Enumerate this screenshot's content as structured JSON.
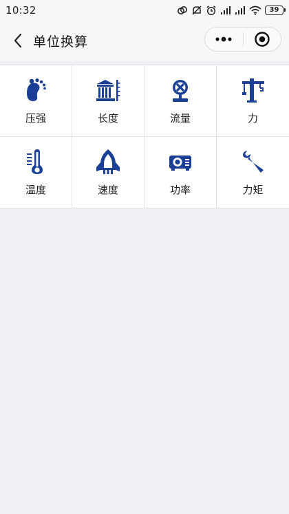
{
  "status_bar": {
    "time": "10:32",
    "battery": "39",
    "icons": [
      "cast-icon",
      "mute-icon",
      "alarm-icon",
      "signal-icon",
      "signal-icon",
      "wifi-icon",
      "battery-icon"
    ]
  },
  "nav": {
    "title": "单位换算",
    "back_icon": "chevron-left-icon",
    "more_icon": "more-dots-icon",
    "close_icon": "target-circle-icon"
  },
  "accent_color": "#1a3f94",
  "categories": [
    {
      "label": "压强",
      "icon": "footprint-icon"
    },
    {
      "label": "长度",
      "icon": "ruler-building-icon"
    },
    {
      "label": "流量",
      "icon": "valve-icon"
    },
    {
      "label": "力",
      "icon": "crane-icon"
    },
    {
      "label": "温度",
      "icon": "thermometer-icon"
    },
    {
      "label": "速度",
      "icon": "rocket-icon"
    },
    {
      "label": "功率",
      "icon": "projector-icon"
    },
    {
      "label": "力矩",
      "icon": "wrench-icon"
    }
  ]
}
